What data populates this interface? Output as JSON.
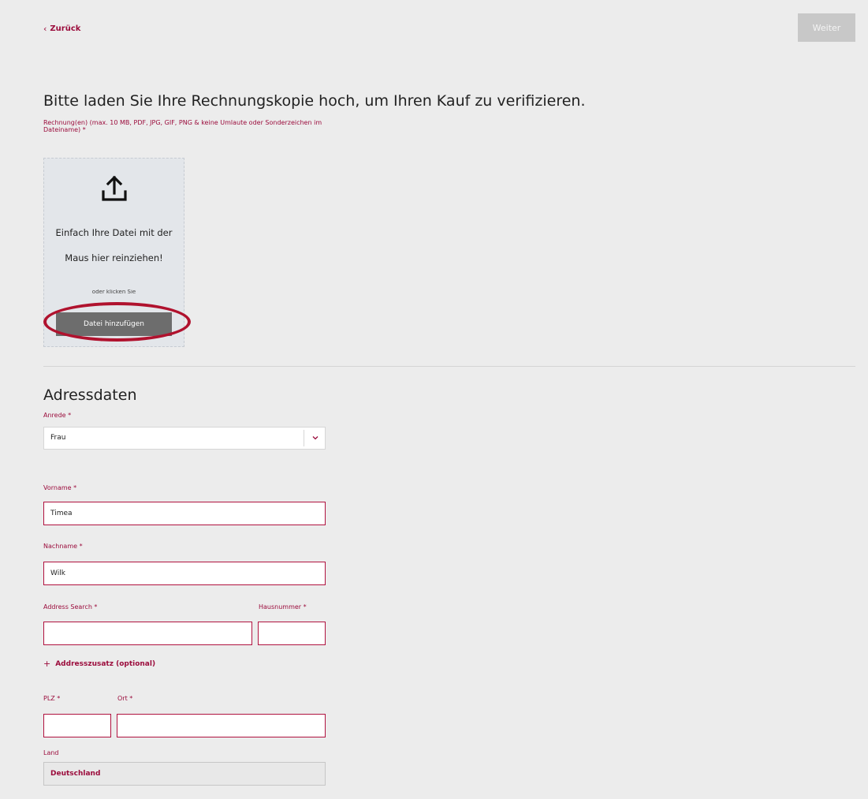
{
  "header": {
    "back_label": "Zurück",
    "next_label": "Weiter"
  },
  "upload": {
    "title": "Bitte laden Sie Ihre Rechnungskopie hoch, um Ihren Kauf zu verifizieren.",
    "hint": "Rechnung(en) (max. 10 MB, PDF, JPG, GIF, PNG & keine Umlaute oder Sonderzeichen im Dateiname) *",
    "dropzone_text": "Einfach Ihre Datei mit der Maus hier reinziehen!",
    "dropzone_subtext": "oder klicken Sie",
    "add_button": "Datei hinzufügen",
    "icon": "upload-icon"
  },
  "address": {
    "title": "Adressdaten",
    "salutation": {
      "label": "Anrede *",
      "value": "Frau",
      "icon": "chevron-down-icon"
    },
    "first_name": {
      "label": "Vorname *",
      "value": "Timea"
    },
    "last_name": {
      "label": "Nachname *",
      "value": "Wilk"
    },
    "address_search": {
      "label": "Address Search *",
      "value": ""
    },
    "house_number": {
      "label": "Hausnummer *",
      "value": ""
    },
    "address_extra": {
      "label": "Addresszusatz (optional)",
      "icon": "plus-icon"
    },
    "zip": {
      "label": "PLZ *",
      "value": ""
    },
    "city": {
      "label": "Ort *",
      "value": ""
    },
    "country": {
      "label": "Land",
      "value": "Deutschland"
    }
  },
  "colors": {
    "accent": "#9b0c3c",
    "highlight": "#b0122e",
    "background": "#ececec",
    "button_disabled": "#c8c8c8",
    "button_dark": "#6d6d6d"
  }
}
